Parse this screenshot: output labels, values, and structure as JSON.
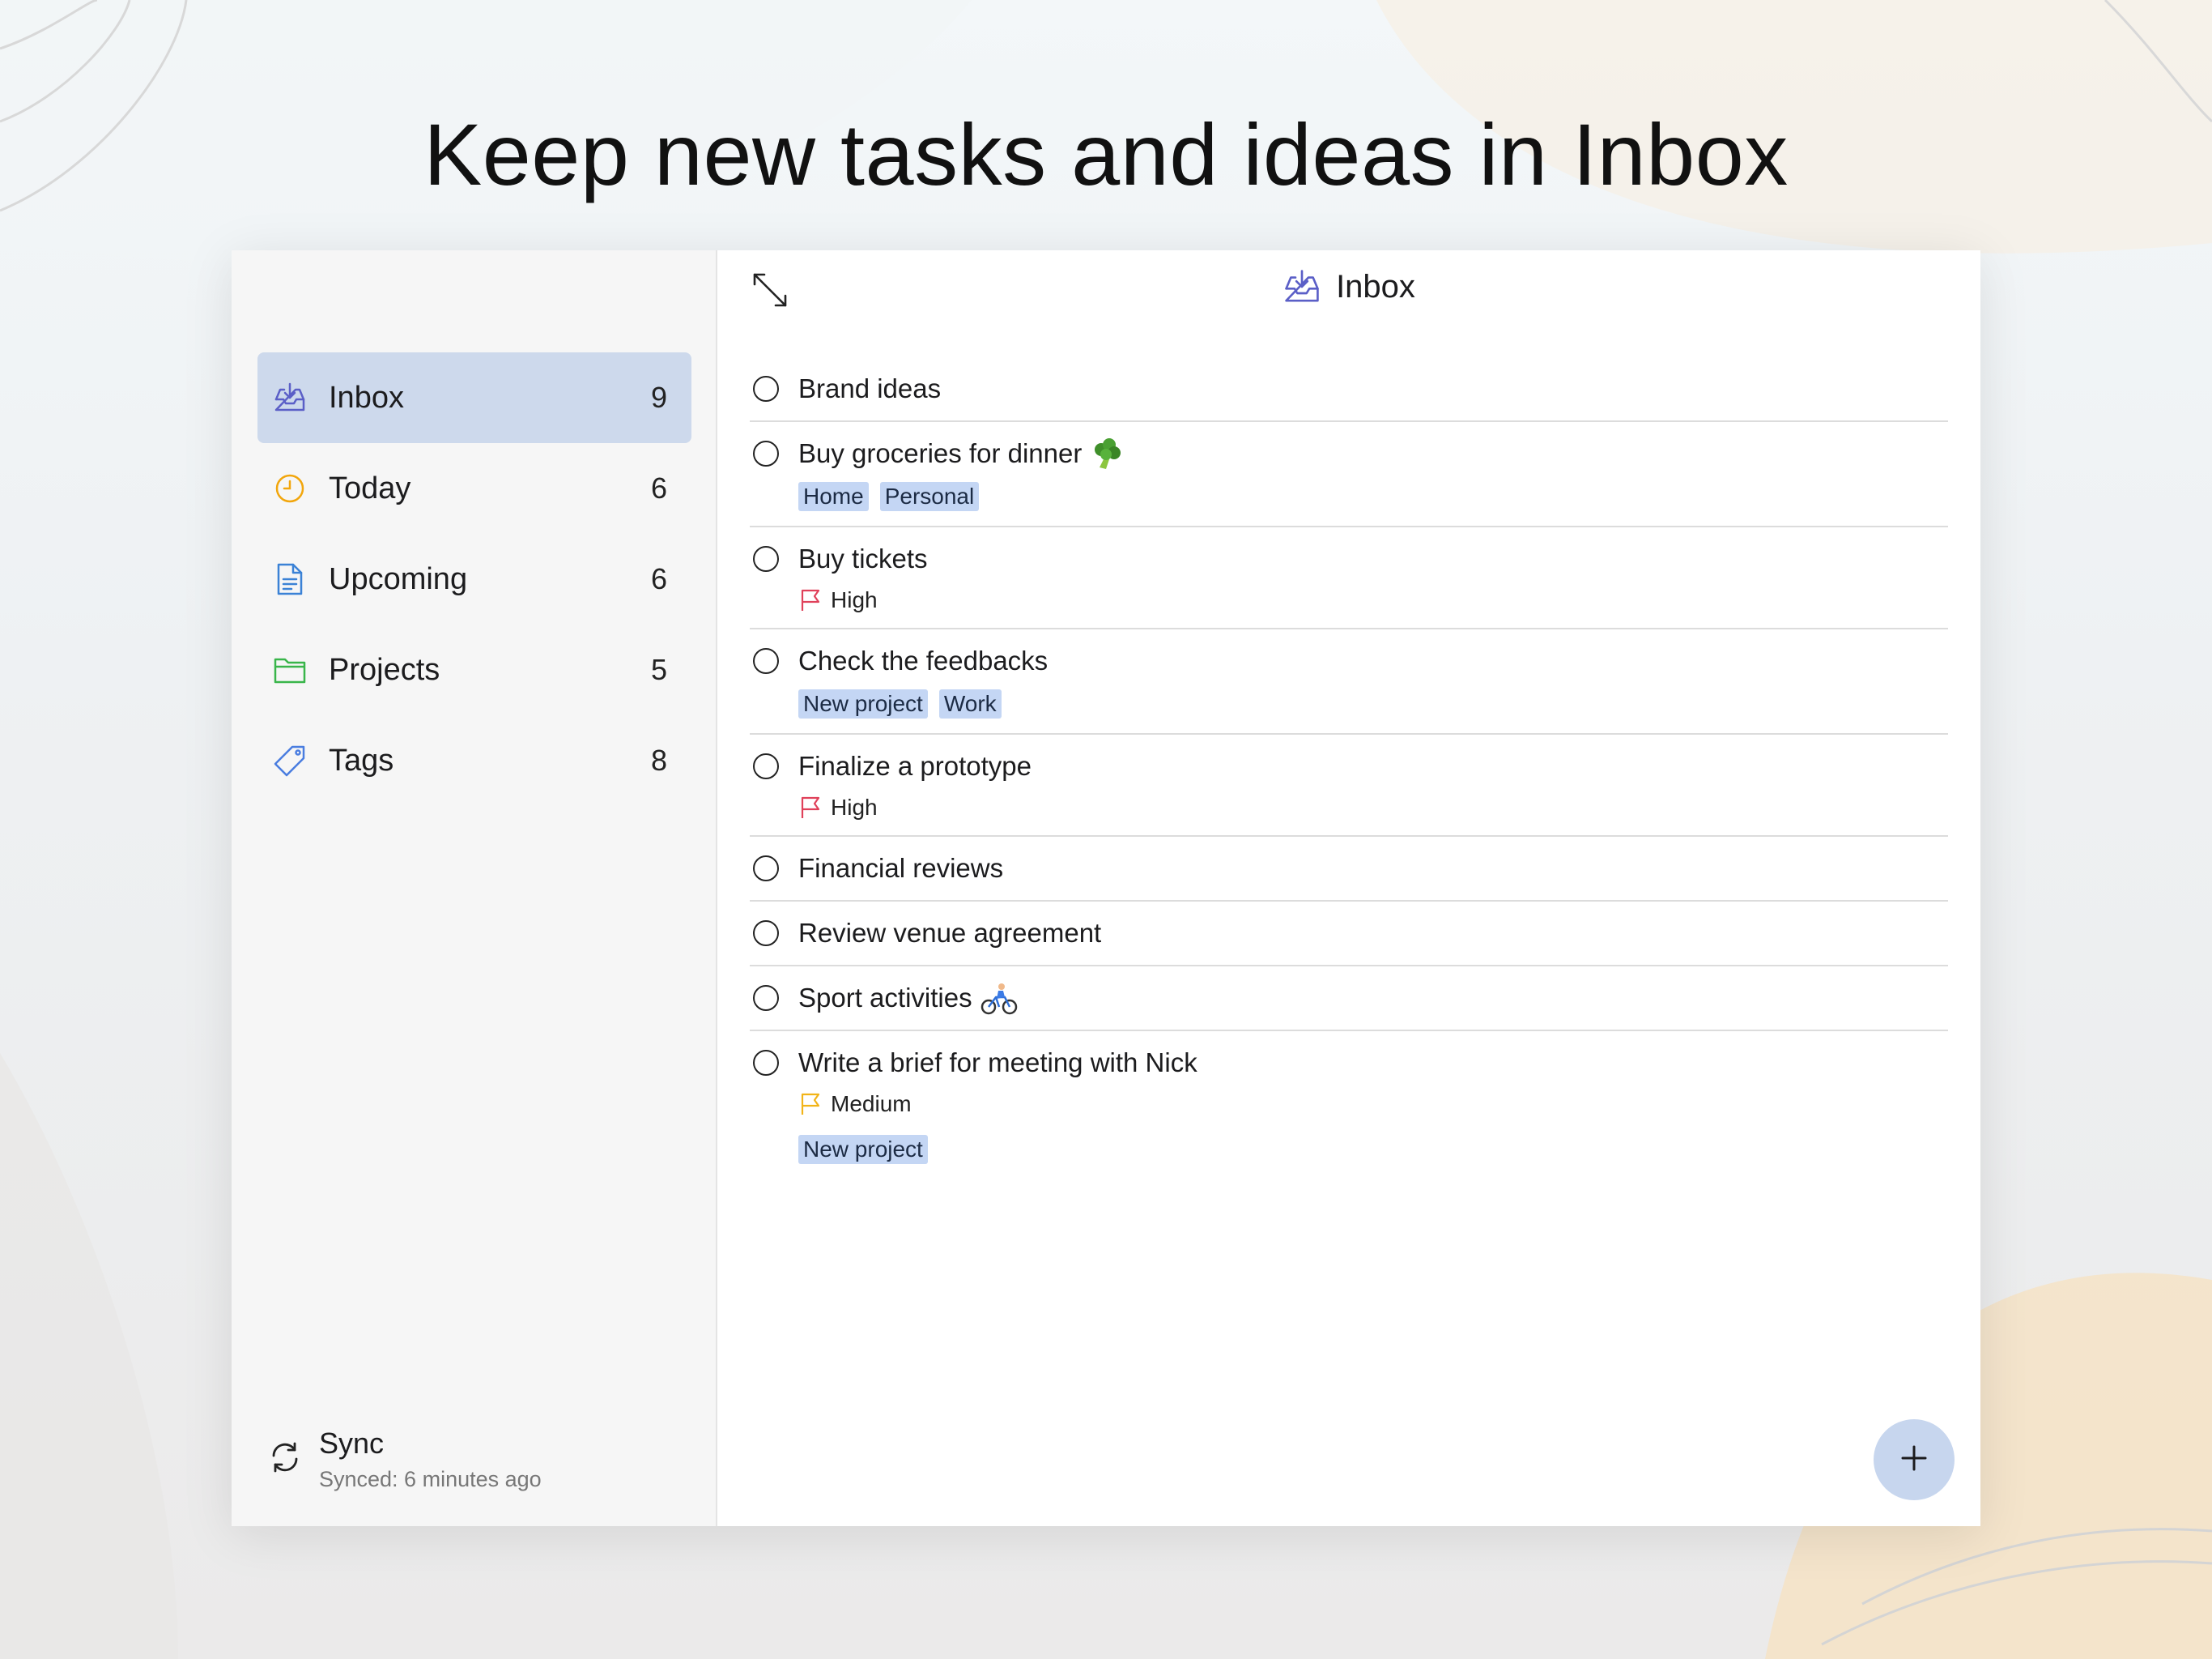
{
  "headline": "Keep new tasks and ideas in Inbox",
  "colors": {
    "accent": "#cdd9ec",
    "tag_bg": "#c4d6f4",
    "priority_high": "#e0415a",
    "priority_medium": "#f2b418",
    "today_icon": "#f2a60c",
    "upcoming_icon": "#3b82d6",
    "projects_icon": "#39b54a",
    "tags_icon": "#4a7de0",
    "inbox_icon": "#5b5fc7"
  },
  "sidebar": {
    "items": [
      {
        "label": "Inbox",
        "count": "9",
        "icon": "inbox-tray-icon"
      },
      {
        "label": "Today",
        "count": "6",
        "icon": "clock-icon"
      },
      {
        "label": "Upcoming",
        "count": "6",
        "icon": "document-icon"
      },
      {
        "label": "Projects",
        "count": "5",
        "icon": "folder-icon"
      },
      {
        "label": "Tags",
        "count": "8",
        "icon": "tag-icon"
      }
    ],
    "sync": {
      "title": "Sync",
      "status": "Synced: 6 minutes ago",
      "icon": "sync-icon"
    }
  },
  "main": {
    "title": "Inbox",
    "tasks": [
      {
        "title": "Brand ideas"
      },
      {
        "title": "Buy groceries for dinner",
        "emoji": "broccoli",
        "tags": [
          "Home",
          "Personal"
        ]
      },
      {
        "title": "Buy tickets",
        "priority": "High"
      },
      {
        "title": "Check the feedbacks",
        "tags": [
          "New project",
          "Work"
        ]
      },
      {
        "title": "Finalize a prototype",
        "priority": "High"
      },
      {
        "title": "Financial reviews"
      },
      {
        "title": "Review venue agreement"
      },
      {
        "title": "Sport activities",
        "emoji": "cyclist"
      },
      {
        "title": "Write a brief for meeting with Nick",
        "priority": "Medium",
        "tags": [
          "New project"
        ]
      }
    ]
  },
  "fab": {
    "icon": "plus-icon"
  }
}
